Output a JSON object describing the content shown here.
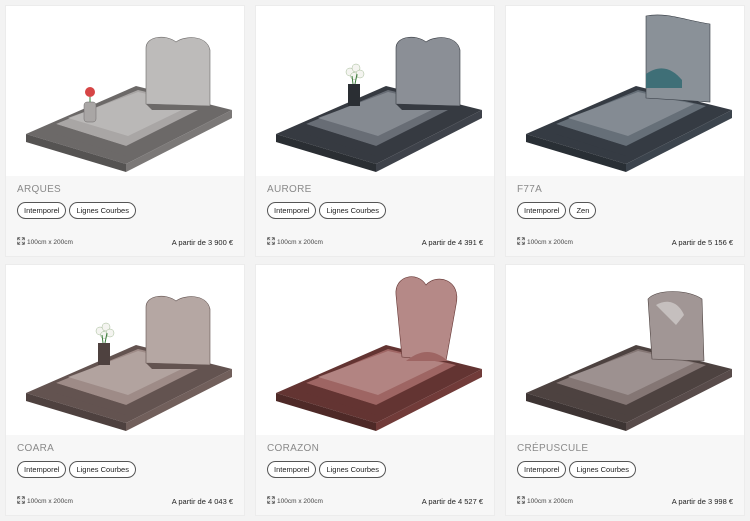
{
  "products": [
    {
      "name": "ARQUES",
      "tags": [
        "Intemporel",
        "Lignes Courbes"
      ],
      "dims": "100cm x 200cm",
      "price": "A partir de 3 900 €",
      "stone": "#9a9695",
      "head": "heart",
      "decor": "vase-red"
    },
    {
      "name": "AURORE",
      "tags": [
        "Intemporel",
        "Lignes Courbes"
      ],
      "dims": "100cm x 200cm",
      "price": "A partir de 4 391 €",
      "stone": "#4d535d",
      "head": "heart",
      "decor": "vase-white"
    },
    {
      "name": "F77A",
      "tags": [
        "Intemporel",
        "Zen"
      ],
      "dims": "100cm x 200cm",
      "price": "A partir de 5 156 €",
      "stone": "#4b5560",
      "head": "wave",
      "decor": "none"
    },
    {
      "name": "COARA",
      "tags": [
        "Intemporel",
        "Lignes Courbes"
      ],
      "dims": "100cm x 200cm",
      "price": "A partir de 4 043 €",
      "stone": "#8d7772",
      "head": "heart",
      "decor": "vase-white"
    },
    {
      "name": "CORAZON",
      "tags": [
        "Intemporel",
        "Lignes Courbes"
      ],
      "dims": "100cm x 200cm",
      "price": "A partir de 4 527 €",
      "stone": "#8d4a47",
      "head": "bigheart",
      "decor": "none"
    },
    {
      "name": "CRÉPUSCULE",
      "tags": [
        "Intemporel",
        "Lignes Courbes"
      ],
      "dims": "100cm x 200cm",
      "price": "A partir de 3 998 €",
      "stone": "#6e5e5c",
      "head": "slab",
      "decor": "none"
    }
  ]
}
